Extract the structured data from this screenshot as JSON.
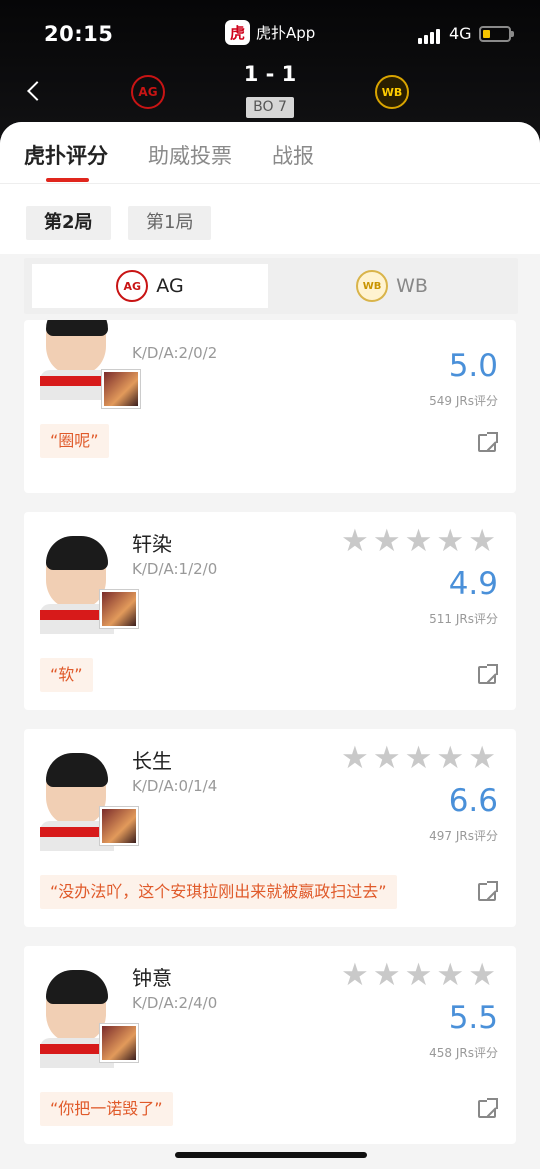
{
  "status_bar": {
    "time": "20:15",
    "app_name": "虎扑App",
    "app_logo_text": "虎",
    "network": "4G"
  },
  "match": {
    "score": "1 - 1",
    "format": "BO 7",
    "team_left": "AG",
    "team_right": "WB"
  },
  "tabs": [
    {
      "label": "虎扑评分",
      "active": true
    },
    {
      "label": "助威投票",
      "active": false
    },
    {
      "label": "战报",
      "active": false
    }
  ],
  "games": [
    {
      "label": "第2局",
      "active": true
    },
    {
      "label": "第1局",
      "active": false
    }
  ],
  "team_selector": [
    {
      "label": "AG",
      "active": true,
      "icon": "ag-logo-icon"
    },
    {
      "label": "WB",
      "active": false,
      "icon": "wb-logo-icon"
    }
  ],
  "players": [
    {
      "name": "",
      "kda": "K/D/A:2/0/2",
      "rating": "5.0",
      "votes": "549 JRs评分",
      "quote": "“圈呢”"
    },
    {
      "name": "轩染",
      "kda": "K/D/A:1/2/0",
      "rating": "4.9",
      "votes": "511 JRs评分",
      "quote": "“软”"
    },
    {
      "name": "长生",
      "kda": "K/D/A:0/1/4",
      "rating": "6.6",
      "votes": "497 JRs评分",
      "quote": "“没办法吖，这个安琪拉刚出来就被嬴政扫过去”"
    },
    {
      "name": "钟意",
      "kda": "K/D/A:2/4/0",
      "rating": "5.5",
      "votes": "458 JRs评分",
      "quote": "“你把一诺毁了”"
    }
  ],
  "colors": {
    "accent_red": "#e0261d",
    "rating_blue": "#4a90d9",
    "quote_orange": "#e05a2a"
  }
}
